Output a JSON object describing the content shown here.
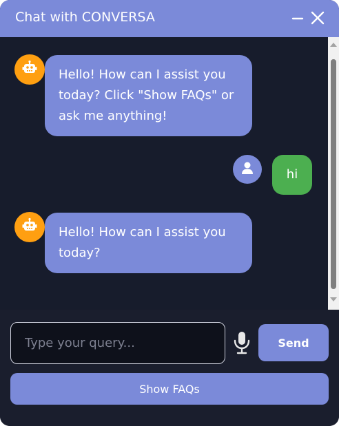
{
  "header": {
    "title": "Chat with CONVERSA",
    "minimize_icon": "minimize-icon",
    "close_icon": "close-icon"
  },
  "messages": [
    {
      "sender": "bot",
      "avatar_icon": "robot-icon",
      "text": "Hello! How can I assist you today? Click \"Show FAQs\" or ask me anything!"
    },
    {
      "sender": "user",
      "avatar_icon": "user-icon",
      "text": "hi"
    },
    {
      "sender": "bot",
      "avatar_icon": "robot-icon",
      "text": "Hello! How can I assist you today?"
    }
  ],
  "composer": {
    "placeholder": "Type your query...",
    "value": "",
    "mic_icon": "microphone-icon",
    "send_label": "Send",
    "faq_label": "Show FAQs"
  },
  "colors": {
    "accent": "#7b8ad9",
    "background": "#171c2c",
    "bot_avatar": "#ff9f11",
    "user_bubble": "#4caf50"
  }
}
